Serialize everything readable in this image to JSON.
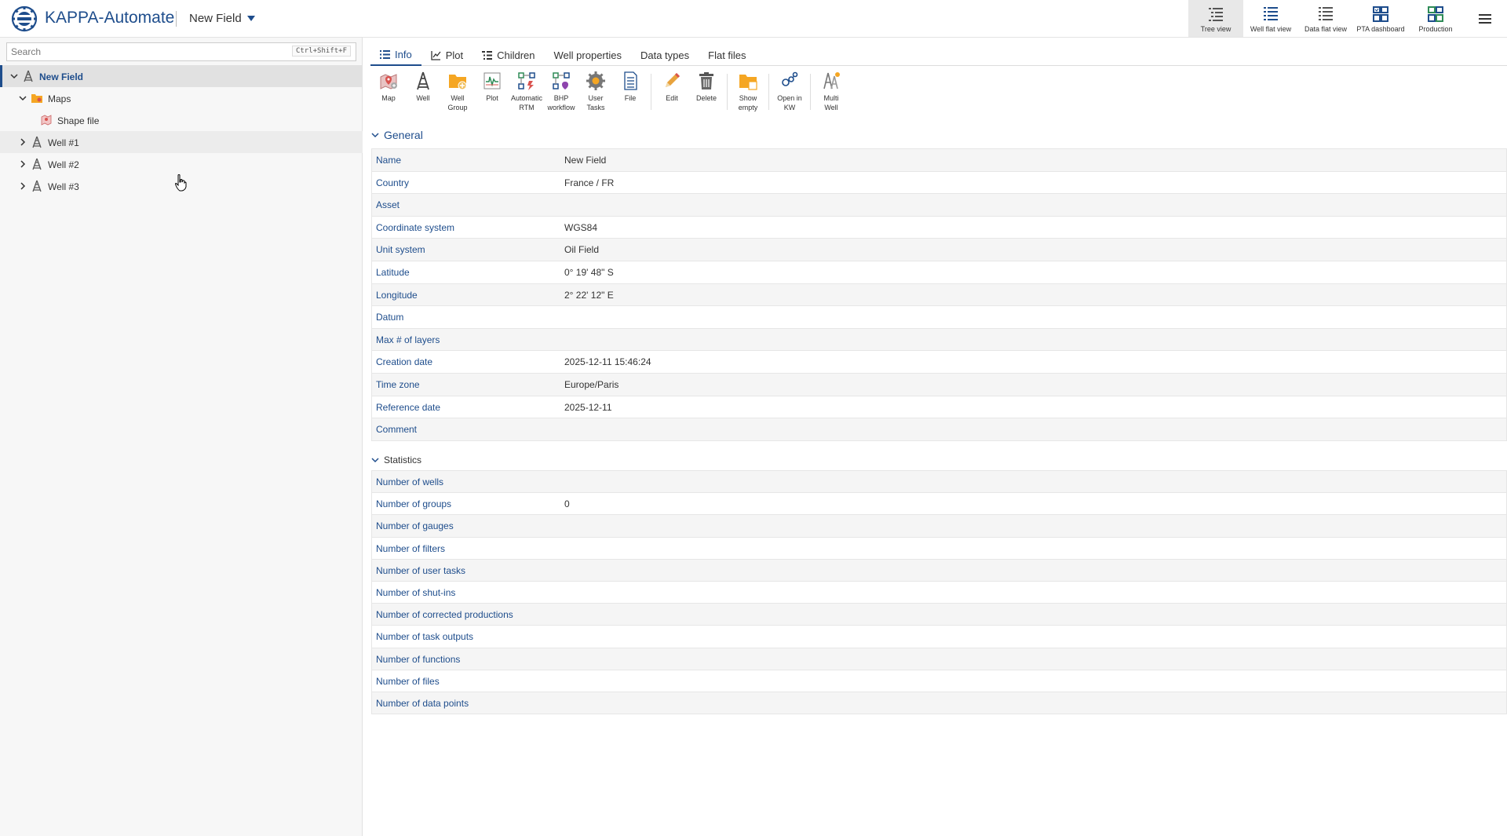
{
  "header": {
    "app_title": "KAPPA-Automate",
    "field_name": "New Field",
    "views": [
      {
        "label": "Tree view",
        "icon": "tree-view-icon"
      },
      {
        "label": "Well flat view",
        "icon": "well-flat-view-icon"
      },
      {
        "label": "Data flat view",
        "icon": "data-flat-view-icon"
      },
      {
        "label": "PTA dashboard",
        "icon": "pta-dashboard-icon"
      },
      {
        "label": "Production",
        "icon": "production-icon"
      }
    ],
    "active_view": "Tree view"
  },
  "sidebar": {
    "search": {
      "placeholder": "Search",
      "shortcut": "Ctrl+Shift+F"
    },
    "tree": [
      {
        "label": "New Field",
        "icon": "field-icon",
        "expanded": true,
        "selected": true
      },
      {
        "label": "Maps",
        "icon": "folder-icon",
        "expanded": true
      },
      {
        "label": "Shape file",
        "icon": "shape-file-icon"
      },
      {
        "label": "Well #1",
        "icon": "well-icon",
        "expanded": false
      },
      {
        "label": "Well #2",
        "icon": "well-icon",
        "expanded": false
      },
      {
        "label": "Well #3",
        "icon": "well-icon",
        "expanded": false
      }
    ]
  },
  "main": {
    "tabs": [
      {
        "label": "Info",
        "icon": "list-icon",
        "active": true
      },
      {
        "label": "Plot",
        "icon": "line-chart-icon"
      },
      {
        "label": "Children",
        "icon": "children-icon"
      },
      {
        "label": "Well properties",
        "icon": ""
      },
      {
        "label": "Data types",
        "icon": ""
      },
      {
        "label": "Flat files",
        "icon": ""
      }
    ],
    "toolbar": [
      {
        "l1": "Map",
        "l2": "",
        "icon": "map-icon"
      },
      {
        "l1": "Well",
        "l2": "",
        "icon": "well-icon"
      },
      {
        "l1": "Well",
        "l2": "Group",
        "icon": "well-group-icon"
      },
      {
        "l1": "Plot",
        "l2": "",
        "icon": "plot-icon"
      },
      {
        "l1": "Automatic",
        "l2": "RTM",
        "icon": "automatic-rtm-icon"
      },
      {
        "l1": "BHP",
        "l2": "workflow",
        "icon": "bhp-workflow-icon"
      },
      {
        "l1": "User",
        "l2": "Tasks",
        "icon": "user-tasks-icon"
      },
      {
        "l1": "File",
        "l2": "",
        "icon": "file-icon"
      },
      {
        "l1": "Edit",
        "l2": "",
        "icon": "edit-icon"
      },
      {
        "l1": "Delete",
        "l2": "",
        "icon": "delete-icon"
      },
      {
        "l1": "Show",
        "l2": "empty",
        "icon": "show-empty-icon"
      },
      {
        "l1": "Open in",
        "l2": "KW",
        "icon": "open-in-kw-icon"
      },
      {
        "l1": "Multi",
        "l2": "Well",
        "icon": "multi-well-icon"
      }
    ],
    "general": {
      "title": "General",
      "rows": [
        {
          "key": "Name",
          "value": "New Field"
        },
        {
          "key": "Country",
          "value": "France / FR"
        },
        {
          "key": "Asset",
          "value": ""
        },
        {
          "key": "Coordinate system",
          "value": "WGS84"
        },
        {
          "key": "Unit system",
          "value": "Oil Field"
        },
        {
          "key": "Latitude",
          "value": "0° 19' 48\" S"
        },
        {
          "key": "Longitude",
          "value": "2° 22' 12\" E"
        },
        {
          "key": "Datum",
          "value": ""
        },
        {
          "key": "Max # of layers",
          "value": ""
        },
        {
          "key": "Creation date",
          "value": "2025-12-11 15:46:24"
        },
        {
          "key": "Time zone",
          "value": "Europe/Paris"
        },
        {
          "key": "Reference date",
          "value": "2025-12-11"
        },
        {
          "key": "Comment",
          "value": ""
        }
      ]
    },
    "statistics": {
      "title": "Statistics",
      "rows": [
        {
          "key": "Number of wells",
          "value": ""
        },
        {
          "key": "Number of groups",
          "value": "0"
        },
        {
          "key": "Number of gauges",
          "value": ""
        },
        {
          "key": "Number of filters",
          "value": ""
        },
        {
          "key": "Number of user tasks",
          "value": ""
        },
        {
          "key": "Number of shut-ins",
          "value": ""
        },
        {
          "key": "Number of corrected productions",
          "value": ""
        },
        {
          "key": "Number of task outputs",
          "value": ""
        },
        {
          "key": "Number of functions",
          "value": ""
        },
        {
          "key": "Number of files",
          "value": ""
        },
        {
          "key": "Number of data points",
          "value": ""
        }
      ]
    }
  },
  "colors": {
    "brand": "#1e4d8c",
    "folder": "#f5a623",
    "delete": "#666666",
    "edit": "#e8a33d"
  }
}
